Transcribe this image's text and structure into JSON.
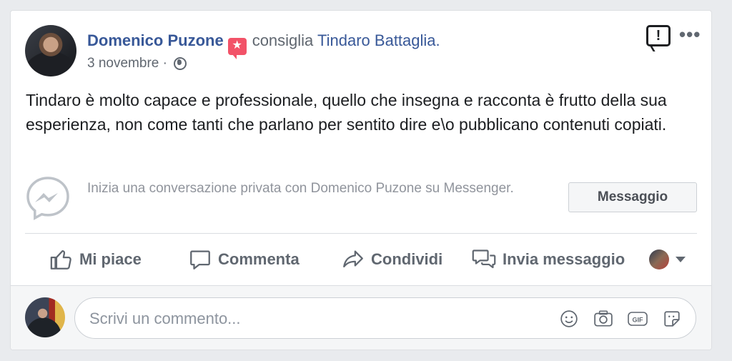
{
  "post": {
    "author": "Domenico Puzone",
    "verb": "consiglia",
    "target": "Tindaro Battaglia.",
    "date": "3 novembre",
    "separator": "·",
    "body": "Tindaro è molto capace e professionale, quello che insegna e racconta è frutto della sua esperienza, non come tanti che parlano per sentito dire e\\o pubblicano contenuti copiati."
  },
  "messenger": {
    "text": "Inizia una conversazione privata con Domenico Puzone su Messenger.",
    "button": "Messaggio"
  },
  "actions": {
    "like": "Mi piace",
    "comment": "Commenta",
    "share": "Condividi",
    "send": "Invia messaggio"
  },
  "comment_box": {
    "placeholder": "Scrivi un commento..."
  },
  "colors": {
    "author_blue": "#385898",
    "recommend_badge": "#f25268",
    "secondary_text": "#606770"
  },
  "icons": [
    "recommendation-badge-icon",
    "globe-icon",
    "report-icon",
    "more-options-icon",
    "messenger-icon",
    "like-icon",
    "comment-icon",
    "share-icon",
    "send-message-icon",
    "emoji-icon",
    "camera-icon",
    "gif-icon",
    "sticker-icon"
  ]
}
